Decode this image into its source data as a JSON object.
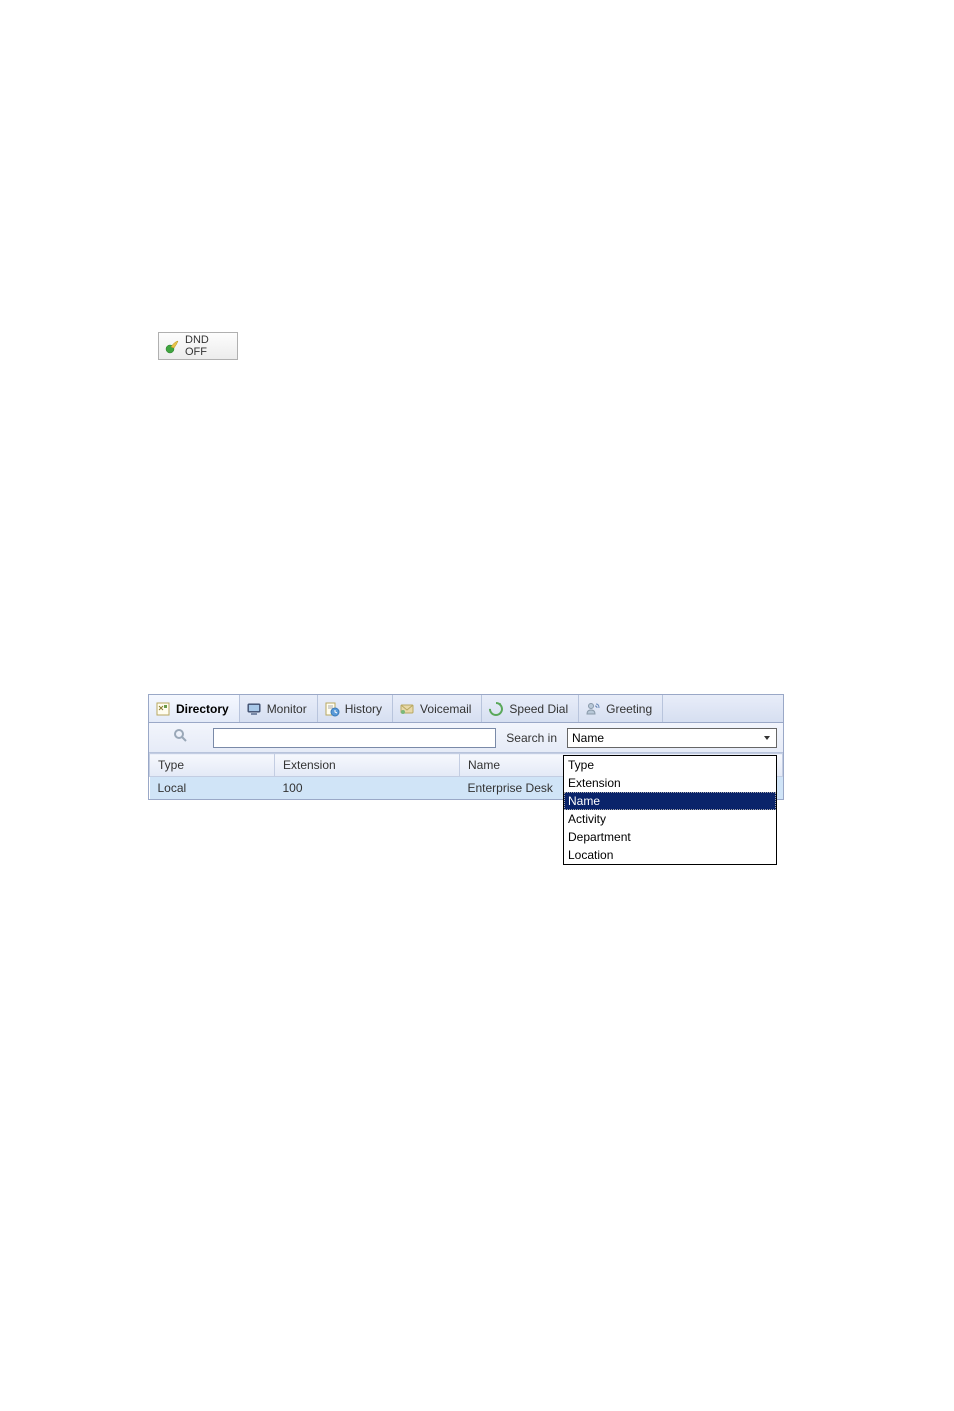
{
  "dnd": {
    "label": "DND OFF"
  },
  "tabs": [
    {
      "label": "Directory",
      "active": true
    },
    {
      "label": "Monitor",
      "active": false
    },
    {
      "label": "History",
      "active": false
    },
    {
      "label": "Voicemail",
      "active": false
    },
    {
      "label": "Speed Dial",
      "active": false
    },
    {
      "label": "Greeting",
      "active": false
    }
  ],
  "search": {
    "value": "",
    "label": "Search in",
    "selected": "Name",
    "options": [
      "Type",
      "Extension",
      "Name",
      "Activity",
      "Department",
      "Location"
    ]
  },
  "table": {
    "columns": [
      "Type",
      "Extension",
      "Name"
    ],
    "rows": [
      {
        "type": "Local",
        "extension": "100",
        "name": "Enterprise Desk"
      }
    ]
  }
}
